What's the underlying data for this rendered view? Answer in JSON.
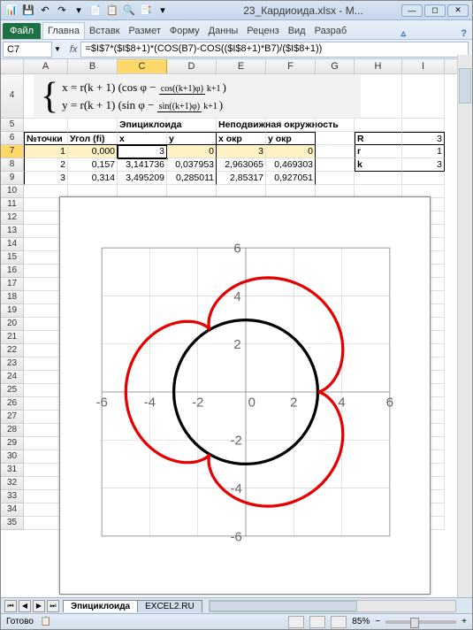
{
  "window": {
    "title": "23_Кардиоида.xlsx - M..."
  },
  "ribbon": {
    "file": "Файл",
    "tabs": [
      "Главна",
      "Вставк",
      "Размет",
      "Форму",
      "Данны",
      "Реценз",
      "Вид",
      "Разраб"
    ]
  },
  "namebox": "C7",
  "fx": "fx",
  "formula": "=$I$7*($I$8+1)*(COS(B7)-COS(($I$8+1)*B7)/($I$8+1))",
  "columns": [
    "A",
    "B",
    "C",
    "D",
    "E",
    "F",
    "G",
    "H",
    "I"
  ],
  "header5": {
    "epicycloid": "Эпициклоида",
    "fixedcircle": "Неподвижная окружность"
  },
  "header6": {
    "n": "№точки",
    "fi": "Угол (fi)",
    "x": "x",
    "y": "y",
    "xokr": "x окр",
    "yokr": "y окр",
    "R": "R",
    "Rval": "3"
  },
  "row7": {
    "n": "1",
    "fi": "0,000",
    "x": "3",
    "y": "0",
    "xokr": "3",
    "yokr": "0",
    "r": "r",
    "rval": "1"
  },
  "row8": {
    "n": "2",
    "fi": "0,157",
    "x": "3,141736",
    "y": "0,037953",
    "xokr": "2,963065",
    "yokr": "0,469303",
    "k": "k",
    "kval": "3"
  },
  "row9": {
    "n": "3",
    "fi": "0,314",
    "x": "3,495209",
    "y": "0,285011",
    "xokr": "2,85317",
    "yokr": "0,927051"
  },
  "formula_display": {
    "x": "x = r(k + 1)",
    "cos": "cos φ −",
    "cosnum": "cos((k+1)φ)",
    "den": "k+1",
    "y": "y = r(k + 1)",
    "sin": "sin φ −",
    "sinnum": "sin((k+1)φ)"
  },
  "chart_data": {
    "type": "line",
    "title": "",
    "xlim": [
      -6,
      6
    ],
    "ylim": [
      -6,
      6
    ],
    "x_ticks": [
      -6,
      -4,
      -2,
      0,
      2,
      4,
      6
    ],
    "y_ticks": [
      -6,
      -4,
      -2,
      0,
      2,
      4,
      6
    ],
    "parameters": {
      "R": 3,
      "r": 1,
      "k": 3
    },
    "series": [
      {
        "name": "Эпициклоида",
        "color": "#e60000",
        "parametric": "x = r(k+1)(cos(t) - cos((k+1)t)/(k+1)); y = r(k+1)(sin(t) - sin((k+1)t)/(k+1))",
        "t_range": [
          0,
          6.283
        ]
      },
      {
        "name": "Неподвижная окружность",
        "color": "#000000",
        "parametric": "x = R cos(t); y = R sin(t)",
        "t_range": [
          0,
          6.283
        ]
      }
    ]
  },
  "sheets": {
    "active": "Эпициклоида",
    "other": "EXCEL2.RU"
  },
  "status": {
    "ready": "Готово",
    "zoom": "85%"
  }
}
